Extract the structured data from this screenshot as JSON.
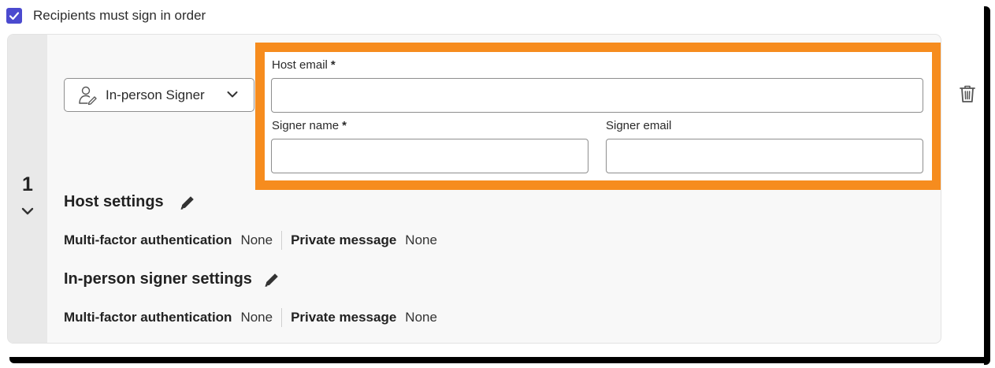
{
  "signing_order": {
    "label": "Recipients must sign in order",
    "checked": true
  },
  "recipient": {
    "index": "1",
    "role": "In-person Signer",
    "host_email": {
      "label": "Host email",
      "required_mark": "*",
      "value": ""
    },
    "signer_name": {
      "label": "Signer name",
      "required_mark": "*",
      "value": ""
    },
    "signer_email": {
      "label": "Signer email",
      "value": ""
    },
    "host_settings": {
      "title": "Host settings",
      "mfa_label": "Multi-factor authentication",
      "mfa_value": "None",
      "message_label": "Private message",
      "message_value": "None"
    },
    "signer_settings": {
      "title": "In-person signer settings",
      "mfa_label": "Multi-factor authentication",
      "mfa_value": "None",
      "message_label": "Private message",
      "message_value": "None"
    }
  },
  "colors": {
    "highlight": "#f68c1e",
    "checkbox": "#4b4acf",
    "index_bar": "#e9e9e9"
  },
  "icons": [
    "check-icon",
    "person-signature-icon",
    "chevron-down-icon",
    "trash-icon",
    "pencil-icon"
  ]
}
